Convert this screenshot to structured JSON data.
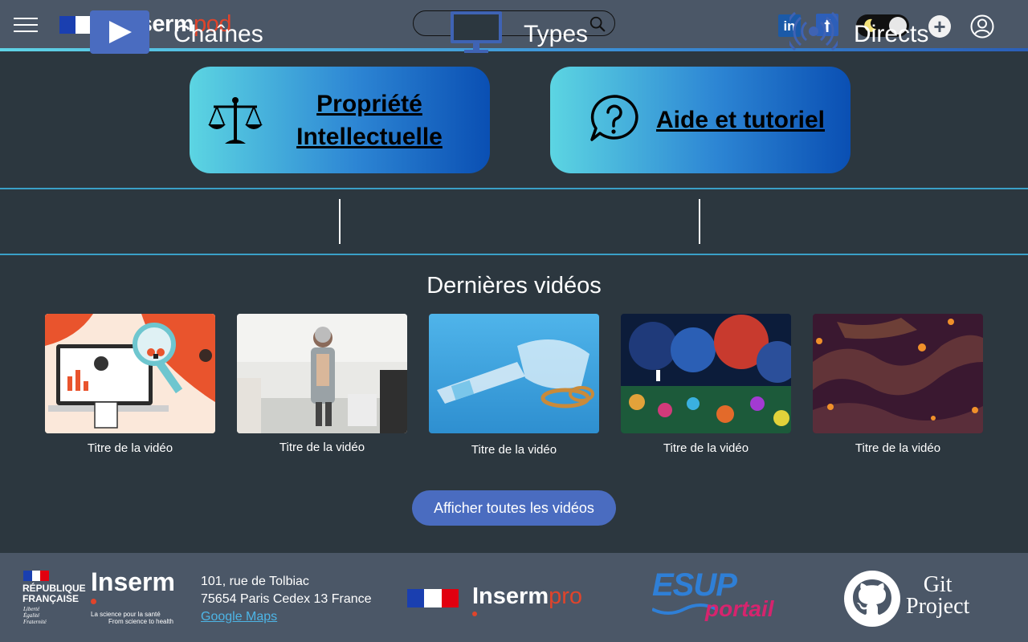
{
  "header": {
    "brand_main": "Inserm",
    "brand_accent": "pod",
    "search_placeholder": "",
    "social": {
      "linkedin_label": "in",
      "facebook_label": "f"
    },
    "plus_label": "+"
  },
  "cards": {
    "intellectual_property": "Propriété Intellectuelle",
    "help": "Aide et tutoriel"
  },
  "categories": [
    {
      "label": "Chaînes",
      "icon": "play-icon"
    },
    {
      "label": "Types",
      "icon": "monitor-icon"
    },
    {
      "label": "Directs",
      "icon": "broadcast-icon"
    }
  ],
  "latest_videos": {
    "title": "Dernières vidéos",
    "videos": [
      {
        "title": "Titre de la vidéo"
      },
      {
        "title": "Titre de la vidéo"
      },
      {
        "title": "Titre de la vidéo"
      },
      {
        "title": "Titre de la vidéo"
      },
      {
        "title": "Titre de la vidéo"
      }
    ],
    "all_button": "Afficher toutes les vidéos"
  },
  "footer": {
    "republique": [
      "RÉPUBLIQUE",
      "FRANÇAISE"
    ],
    "motto": [
      "Liberté",
      "Égalité",
      "Fraternité"
    ],
    "inserm": "Inserm",
    "inserm_tagline_fr": "La science pour la santé",
    "inserm_tagline_en": "From science to health",
    "address_line1": "101, rue de Tolbiac",
    "address_line2": "75654 Paris Cedex 13 France",
    "maps_link": "Google Maps",
    "pro_main": "Inserm",
    "pro_accent": "pro",
    "esup_top": "ESUP",
    "esup_bottom": "portail",
    "git_line1": "Git",
    "git_line2": "Project"
  },
  "colors": {
    "background": "#2c373f",
    "header": "#4b5767",
    "accent_red": "#e0442b",
    "button_blue": "#4a6cc0",
    "link_blue": "#4db5e6"
  }
}
